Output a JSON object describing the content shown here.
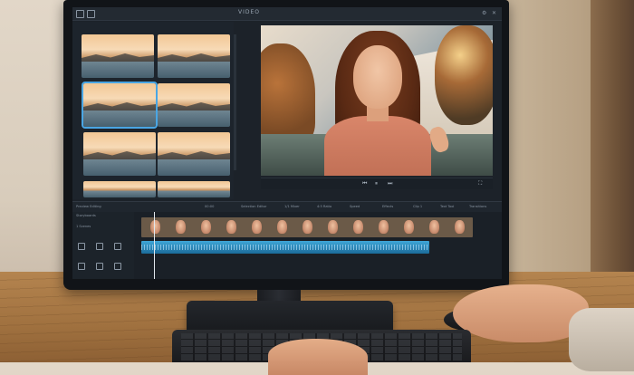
{
  "app": {
    "title": "VIDEO"
  },
  "timeline": {
    "header_labels": [
      "Preview Editing",
      "00:00",
      "Selection Editor",
      "1/1 Mixer",
      "4:5 Ratio",
      "Speed",
      "Effects",
      "Clip 1",
      "Text Tool",
      "Transitions"
    ],
    "left_labels": [
      "Storyboards",
      "1 Scenes"
    ]
  },
  "viewer": {
    "controls": [
      "⏮",
      "⏸",
      "⏭",
      "⛶"
    ]
  },
  "colors": {
    "accent": "#4aa6e4",
    "audio_track": "#3fa6d8",
    "panel_bg": "#1c2229"
  }
}
